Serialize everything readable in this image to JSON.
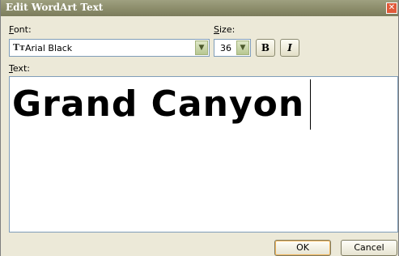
{
  "dialog": {
    "title": "Edit WordArt Text",
    "close_glyph": "✕"
  },
  "font": {
    "label_accel": "F",
    "label_rest": "ont:",
    "value": "Arial Black",
    "icon": "truetype-font-icon",
    "icon_glyph": "Tт"
  },
  "size": {
    "label_accel": "S",
    "label_rest": "ize:",
    "value": "36"
  },
  "format": {
    "bold_label": "B",
    "italic_label": "I"
  },
  "text": {
    "label_accel": "T",
    "label_rest": "ext:",
    "value": "Grand Canyon"
  },
  "buttons": {
    "ok": "OK",
    "cancel": "Cancel"
  },
  "colors": {
    "dialog_bg": "#ece9d8",
    "titlebar": "#8b8c6a",
    "dropdown_arrow": "#b7c791"
  }
}
